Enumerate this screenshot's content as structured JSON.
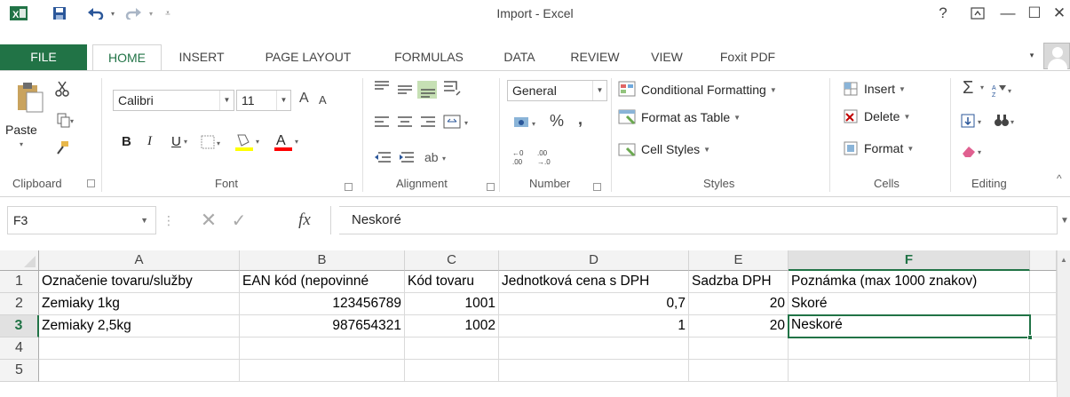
{
  "window": {
    "title": "Import - Excel",
    "help": "?",
    "restore_icon": "ribbon-display-icon",
    "minimize": "—",
    "maximize": "☐",
    "close": "✕"
  },
  "qat": {
    "save": "save-icon",
    "undo": "undo-icon",
    "redo": "redo-icon"
  },
  "tabs": [
    "FILE",
    "HOME",
    "INSERT",
    "PAGE LAYOUT",
    "FORMULAS",
    "DATA",
    "REVIEW",
    "VIEW",
    "Foxit PDF"
  ],
  "ribbon": {
    "clipboard": {
      "paste": "Paste",
      "label": "Clipboard"
    },
    "font": {
      "name": "Calibri",
      "size": "11",
      "bold": "B",
      "italic": "I",
      "underline": "U",
      "grow": "A",
      "shrink": "A",
      "font_color_letter": "A",
      "label": "Font"
    },
    "alignment": {
      "label": "Alignment"
    },
    "number": {
      "format": "General",
      "percent": "%",
      "comma": ",",
      "label": "Number"
    },
    "styles": {
      "conditional": "Conditional Formatting",
      "table": "Format as Table",
      "cell_styles": "Cell Styles",
      "label": "Styles"
    },
    "cells": {
      "insert": "Insert",
      "delete": "Delete",
      "format": "Format",
      "label": "Cells"
    },
    "editing": {
      "sum": "Σ",
      "label": "Editing"
    }
  },
  "formula_bar": {
    "name_box": "F3",
    "fx": "fx",
    "value": "Neskoré"
  },
  "accent": "#217346",
  "sheet": {
    "columns": [
      "A",
      "B",
      "C",
      "D",
      "E",
      "F"
    ],
    "selected_column": "F",
    "selected_row": "3",
    "rows": [
      {
        "num": "1",
        "cells": [
          "Označenie tovaru/služby",
          "EAN kód (nepovinné",
          "Kód tovaru",
          "Jednotková cena s DPH",
          "Sadzba DPH",
          "Poznámka (max 1000 znakov)"
        ]
      },
      {
        "num": "2",
        "cells": [
          "Zemiaky 1kg",
          "123456789",
          "1001",
          "0,7",
          "20",
          "Skoré"
        ]
      },
      {
        "num": "3",
        "cells": [
          "Zemiaky 2,5kg",
          "987654321",
          "1002",
          "1",
          "20",
          "Neskoré"
        ]
      },
      {
        "num": "4",
        "cells": [
          "",
          "",
          "",
          "",
          "",
          ""
        ]
      },
      {
        "num": "5",
        "cells": [
          "",
          "",
          "",
          "",
          "",
          ""
        ]
      }
    ]
  }
}
